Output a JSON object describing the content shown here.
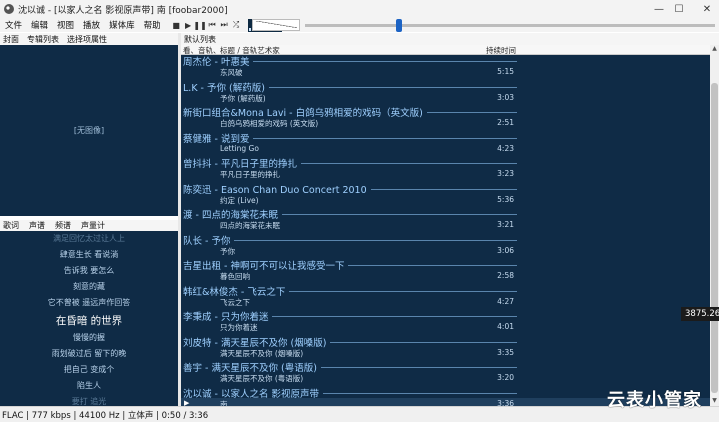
{
  "window": {
    "title": "沈以诚 - [以家人之名 影视原声带] 南  [foobar2000]",
    "minimize_glyph": "—",
    "maximize_glyph": "☐",
    "close_glyph": "✕"
  },
  "menu": [
    "文件",
    "编辑",
    "视图",
    "播放",
    "媒体库",
    "帮助"
  ],
  "toolbar": {
    "stop": "■",
    "play": "▶",
    "pause": "❚❚",
    "prev": "⏮",
    "next": "⏭",
    "random": "⤮"
  },
  "seek": {
    "position": 0.23
  },
  "volume": {
    "level": 1.0
  },
  "left_top_bar": [
    "封面",
    "专辑列表",
    "选择项属性"
  ],
  "cover": {
    "placeholder": "[无图像]"
  },
  "left_bottom_bar": [
    "歌词",
    "声谱",
    "频谱",
    "声量计"
  ],
  "lyrics": [
    "满足回忆太过让人上",
    "肆意生长 看说淌",
    "告诉我 要怎么",
    "刻意的藏",
    "它不曾被 遥远声作回答",
    "在昏暗 的世界",
    "慢慢的握",
    "雨划破过后 留下的晚",
    "把自己 变成个",
    "陷生人",
    "要打 追光"
  ],
  "playlist_tab": "默认列表",
  "columns": {
    "c1": "看、音轨、",
    "c2": "标题 / 音轨艺术家",
    "c3": "持续时间"
  },
  "playlist": [
    {
      "group": "周杰伦 - 叶惠美",
      "track": "东风破",
      "duration": "5:15"
    },
    {
      "group": "L.K - 予你 (解药版)",
      "track": "予你 (解药版)",
      "duration": "3:03"
    },
    {
      "group": "新街口组合&Mona Lavi - 白鸽乌鸦相爱的戏码（英文版)",
      "track": "白鸽乌鸦相爱的戏码 (英文版)",
      "duration": "2:51"
    },
    {
      "group": "蔡健雅 - 说到爱",
      "track": "Letting Go",
      "duration": "4:23"
    },
    {
      "group": "曾抖抖 - 平凡日子里的挣扎",
      "track": "平凡日子里的挣扎",
      "duration": "3:23"
    },
    {
      "group": "陈奕迅 - Eason Chan Duo Concert 2010",
      "track": "约定 (Live)",
      "duration": "5:36"
    },
    {
      "group": "渡 - 四点的海棠花未眠",
      "track": "四点的海棠花未眠",
      "duration": "3:21"
    },
    {
      "group": "队长 - 予你",
      "track": "予你",
      "duration": "3:06"
    },
    {
      "group": "吉星出租 - 神啊可不可以让我感受一下",
      "track": "暮色回响",
      "duration": "2:58"
    },
    {
      "group": "韩红&林俊杰 - 飞云之下",
      "track": "飞云之下",
      "duration": "4:27"
    },
    {
      "group": "李秉成 - 只为你着迷",
      "track": "只为你着迷",
      "duration": "4:01"
    },
    {
      "group": "刘皮特 - 满天星辰不及你 (烟嗓版)",
      "track": "满天星辰不及你 (烟嗓版)",
      "duration": "3:35"
    },
    {
      "group": "善宇 - 满天星辰不及你 (粤语版)",
      "track": "满天星辰不及你 (粤语版)",
      "duration": "3:20"
    },
    {
      "group": "沈以诚 - 以家人之名 影视原声带",
      "track": "南",
      "duration": "3:36",
      "playing": true
    }
  ],
  "status": "FLAC | 777 kbps | 44100 Hz | 立体声 | 0:50 / 3:36",
  "tooltip": "3875.26",
  "watermark": "云表小管家",
  "icons": {
    "app": "foobar-app-icon",
    "playing": "▶"
  },
  "colors": {
    "panel_bg": "#0f2b46",
    "group_text": "#9fd0ff",
    "track_text": "#c6dbef",
    "seek_knob": "#1c63c4"
  }
}
